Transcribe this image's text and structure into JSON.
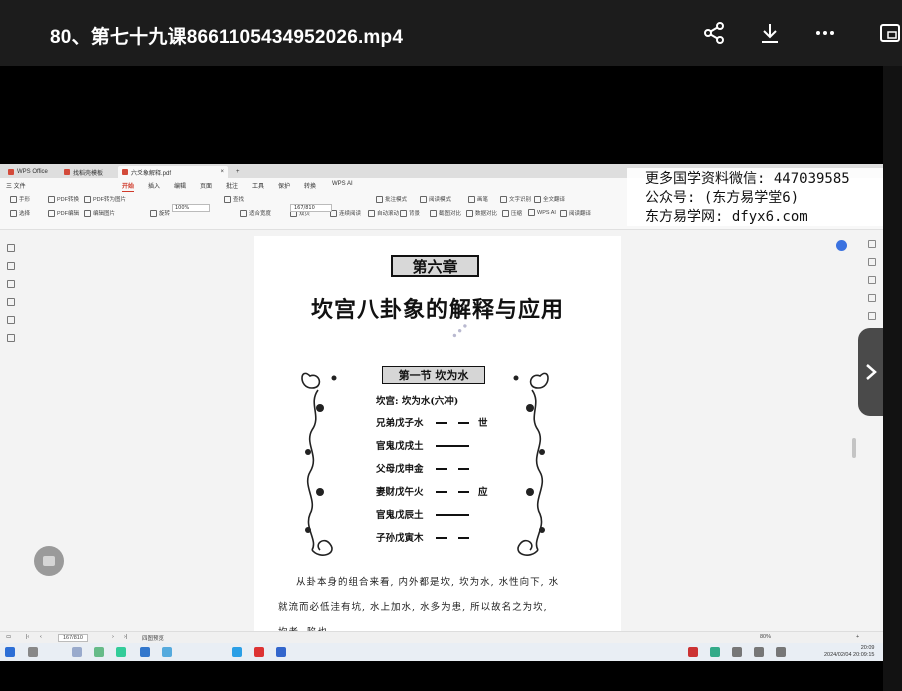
{
  "player": {
    "title": "80、第七十九课8661105434952026.mp4",
    "actions": [
      "share-icon",
      "download-icon",
      "more-icon",
      "window-icon"
    ]
  },
  "wps": {
    "tabs": [
      {
        "label": "WPS Office",
        "color": "#d34a3a"
      },
      {
        "label": "找稻壳模板",
        "color": "#d34a3a"
      },
      {
        "label": "六爻象解释.pdf",
        "color": "#d34a3a"
      }
    ],
    "new_tab": "+",
    "menu": [
      "三 文件",
      "开始",
      "插入",
      "编辑",
      "页面",
      "批注",
      "工具",
      "保护",
      "转换",
      "WPS AI"
    ],
    "active_menu": "开始",
    "toolbar": {
      "row1": [
        "手形",
        "PDF转换",
        "PDF转为图片",
        "查找",
        "批注模式",
        "阅读模式",
        "画笔",
        "文字识别",
        "全文翻译"
      ],
      "row2": [
        "选择",
        "PDF编辑",
        "编辑图片",
        "旋转",
        "适合宽度",
        "双页",
        "连续阅读",
        "自动滚动",
        "背景",
        "截图对比",
        "数据对比",
        "压缩",
        "WPS AI",
        "阅读翻译"
      ],
      "zoom": "100%",
      "page": "167/810"
    }
  },
  "overlay": {
    "line1": "更多国学资料微信: 447039585",
    "line2": "公众号: (东方易学堂6)",
    "line3": "东方易学网: dfyx6.com"
  },
  "document": {
    "chapter_label": "第六章",
    "chapter_title": "坎宫八卦象的解释与应用",
    "section_label": "第一节 坎为水",
    "gua_title": "坎宫: 坎为水(六冲)",
    "yao": [
      {
        "name": "兄弟戊子水",
        "line": "yin",
        "mark": "世"
      },
      {
        "name": "官鬼戊戌土",
        "line": "yang",
        "mark": ""
      },
      {
        "name": "父母戊申金",
        "line": "yin",
        "mark": ""
      },
      {
        "name": "妻财戊午火",
        "line": "yin",
        "mark": "应"
      },
      {
        "name": "官鬼戊辰土",
        "line": "yang",
        "mark": ""
      },
      {
        "name": "子孙戊寅木",
        "line": "yin",
        "mark": ""
      }
    ],
    "para1": "从卦本身的组合来看, 内外都是坎, 坎为水, 水性向下, 水",
    "para2": "就流而必低洼有坑, 水上加水, 水多为患, 所以故名之为坎,",
    "para3": "坎者, 陷也"
  },
  "status": {
    "page": "167/810",
    "mode": "四图预览",
    "zoom": "80%",
    "clock_time": "20:09",
    "clock_date": "2024/02/04 20:09:15"
  },
  "colors": {
    "accent": "#d03a2a",
    "player_bar": "#1c1c1c",
    "blue_button": "#3b72e0"
  }
}
